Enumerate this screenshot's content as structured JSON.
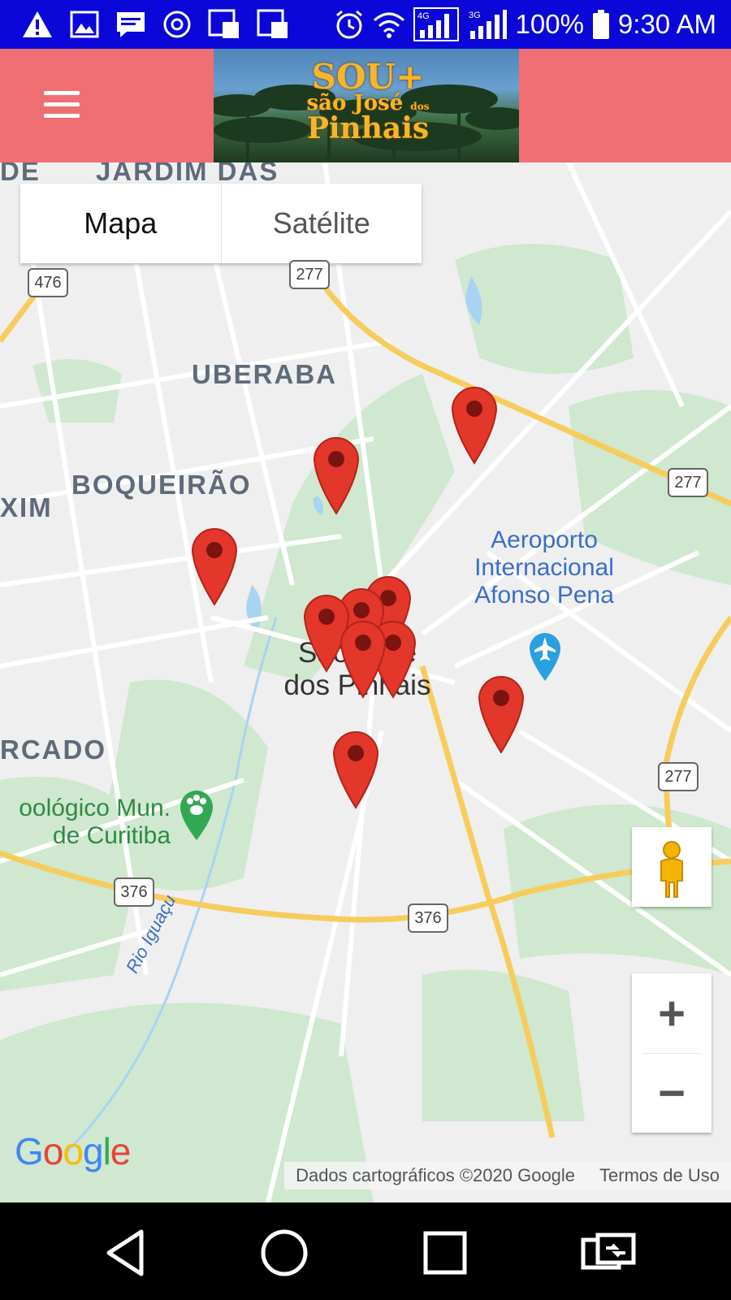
{
  "status_bar": {
    "battery": "100%",
    "time": "9:30 AM",
    "network_badge": "4G",
    "signal_badge": "3G",
    "icons": [
      "warning-icon",
      "image-icon",
      "message-icon",
      "email-icon",
      "cal-icon",
      "cal-icon",
      "alarm-icon",
      "wifi-icon",
      "signal-icon",
      "signal-icon",
      "battery-icon"
    ]
  },
  "header": {
    "menu_icon": "hamburger-menu-icon",
    "banner_line1": "SOU+",
    "banner_line2": "são José",
    "banner_line3": "dos",
    "banner_line4": "Pinhais",
    "colors": {
      "header_bg": "#ef6f74",
      "banner_text": "#f7b52a"
    }
  },
  "map": {
    "map_type_toggle": {
      "map_label": "Mapa",
      "satellite_label": "Satélite",
      "selected": "Mapa"
    },
    "labels": {
      "jardim": "JARDIM DAS",
      "de": "DE",
      "uberaba": "UBERABA",
      "boqueirao": "BOQUEIRÃO",
      "xim": "XIM",
      "rcado": "RCADO",
      "city_line1": "São José",
      "city_line2": "dos Pinhais",
      "airport_line1": "Aeroporto",
      "airport_line2": "Internacional",
      "airport_line3": "Afonso Pena",
      "zoo_line1": "oológico Mun.",
      "zoo_line2": "de Curitiba",
      "river": "Rio Iguaçu"
    },
    "road_shields": [
      "476",
      "277",
      "277",
      "277",
      "376",
      "376"
    ],
    "marker_count": 11,
    "controls": {
      "pegman_icon": "pegman-icon",
      "zoom_in_label": "+",
      "zoom_out_label": "−"
    },
    "attribution": {
      "data": "Dados cartográficos ©2020 Google",
      "terms": "Termos de Uso"
    },
    "logo": "Google",
    "colors": {
      "marker": "#e2372a",
      "road_major": "#f6cd5c",
      "green": "#cde9cd",
      "water": "#a9d3f2"
    }
  },
  "nav_bar": {
    "back_icon": "back-triangle-icon",
    "home_icon": "home-circle-icon",
    "recents_icon": "recents-square-icon",
    "switch_icon": "switch-apps-icon"
  }
}
